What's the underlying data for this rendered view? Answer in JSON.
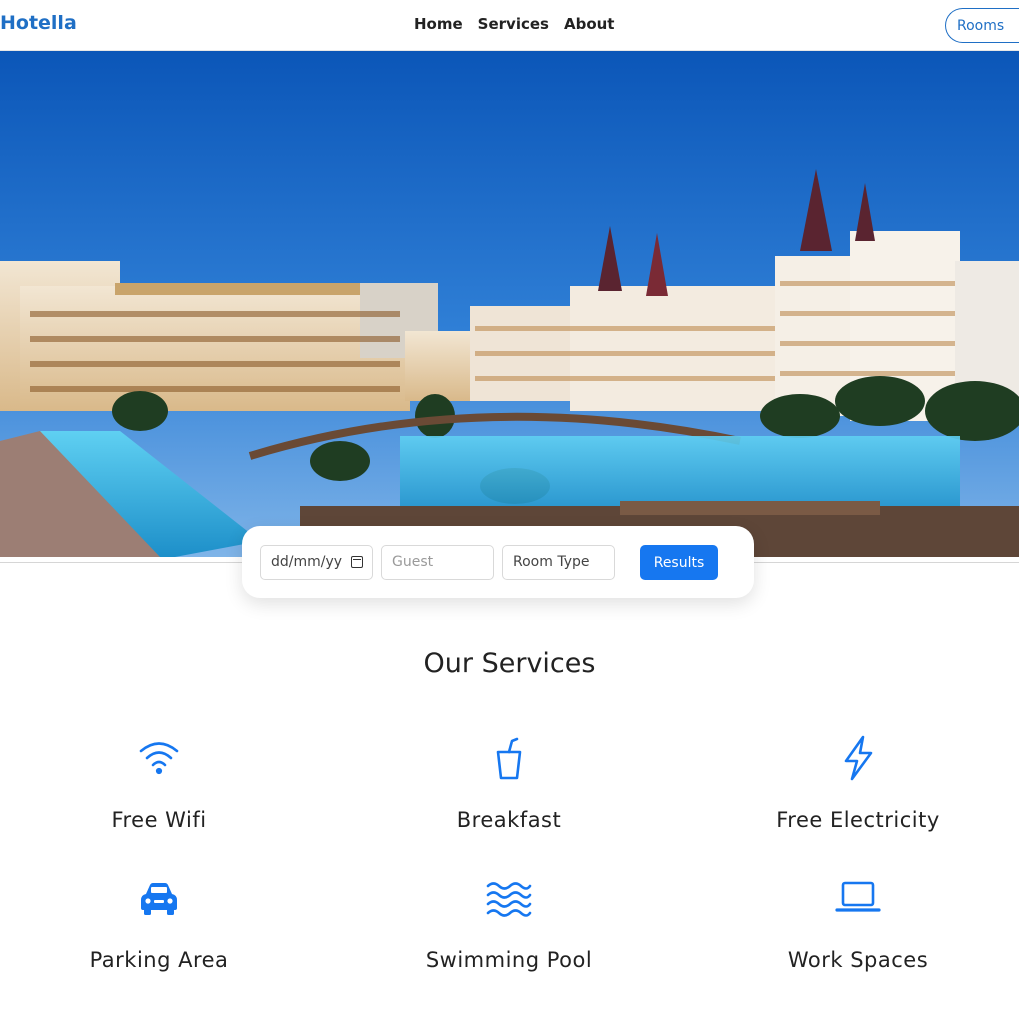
{
  "header": {
    "brand": "Hotella",
    "nav": [
      {
        "label": "Home"
      },
      {
        "label": "Services"
      },
      {
        "label": "About"
      }
    ],
    "rooms_button": "Rooms"
  },
  "search": {
    "date_placeholder": "dd/mm/yy",
    "guest_placeholder": "Guest",
    "room_type": "Room Type",
    "results_label": "Results"
  },
  "services": {
    "title": "Our Services",
    "items": [
      {
        "label": "Free Wifi",
        "icon": "wifi-icon"
      },
      {
        "label": "Breakfast",
        "icon": "cup-icon"
      },
      {
        "label": "Free Electricity",
        "icon": "lightning-icon"
      },
      {
        "label": "Parking Area",
        "icon": "car-icon"
      },
      {
        "label": "Swimming Pool",
        "icon": "waves-icon"
      },
      {
        "label": "Work Spaces",
        "icon": "laptop-icon"
      }
    ]
  },
  "colors": {
    "accent": "#1677f0",
    "brand": "#1f6fc5"
  }
}
